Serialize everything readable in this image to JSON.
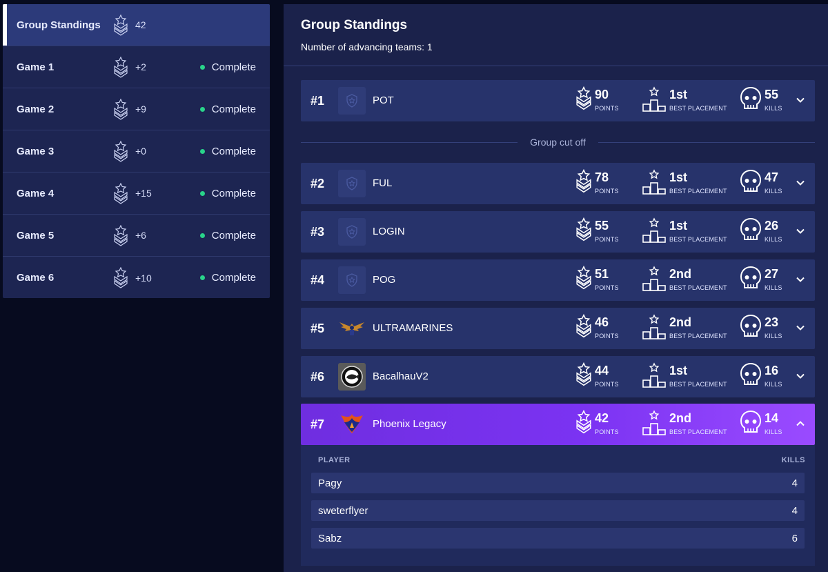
{
  "sidebar": {
    "items": [
      {
        "label": "Group Standings",
        "points": "42",
        "status": "",
        "active": true
      },
      {
        "label": "Game 1",
        "points": "+2",
        "status": "Complete"
      },
      {
        "label": "Game 2",
        "points": "+9",
        "status": "Complete"
      },
      {
        "label": "Game 3",
        "points": "+0",
        "status": "Complete"
      },
      {
        "label": "Game 4",
        "points": "+15",
        "status": "Complete"
      },
      {
        "label": "Game 5",
        "points": "+6",
        "status": "Complete"
      },
      {
        "label": "Game 6",
        "points": "+10",
        "status": "Complete"
      }
    ]
  },
  "main": {
    "title": "Group Standings",
    "subtitle": "Number of advancing teams: 1",
    "cutoff_label": "Group cut off",
    "stat_labels": {
      "points": "POINTS",
      "placement": "BEST PLACEMENT",
      "kills": "KILLS"
    },
    "teams": [
      {
        "rank": "#1",
        "name": "POT",
        "points": "90",
        "placement": "1st",
        "kills": "55",
        "logo": "shield-icon"
      },
      {
        "rank": "#2",
        "name": "FUL",
        "points": "78",
        "placement": "1st",
        "kills": "47",
        "logo": "shield-icon"
      },
      {
        "rank": "#3",
        "name": "LOGIN",
        "points": "55",
        "placement": "1st",
        "kills": "26",
        "logo": "shield-icon"
      },
      {
        "rank": "#4",
        "name": "POG",
        "points": "51",
        "placement": "2nd",
        "kills": "27",
        "logo": "shield-icon"
      },
      {
        "rank": "#5",
        "name": "ULTRAMARINES",
        "points": "46",
        "placement": "2nd",
        "kills": "23",
        "logo": "eagle-logo"
      },
      {
        "rank": "#6",
        "name": "BacalhauV2",
        "points": "44",
        "placement": "1st",
        "kills": "16",
        "logo": "fish-badge-logo"
      },
      {
        "rank": "#7",
        "name": "Phoenix Legacy",
        "points": "42",
        "placement": "2nd",
        "kills": "14",
        "logo": "phoenix-logo"
      }
    ],
    "expanded": {
      "header_player": "PLAYER",
      "header_kills": "KILLS",
      "players": [
        {
          "name": "Pagy",
          "kills": "4"
        },
        {
          "name": "sweterflyer",
          "kills": "4"
        },
        {
          "name": "Sabz",
          "kills": "6"
        }
      ]
    }
  },
  "colors": {
    "background": "#070b1f",
    "panel": "#1b224b",
    "row": "#27336b",
    "highlight": "#7b33f2",
    "status_dot": "#29d38a"
  }
}
